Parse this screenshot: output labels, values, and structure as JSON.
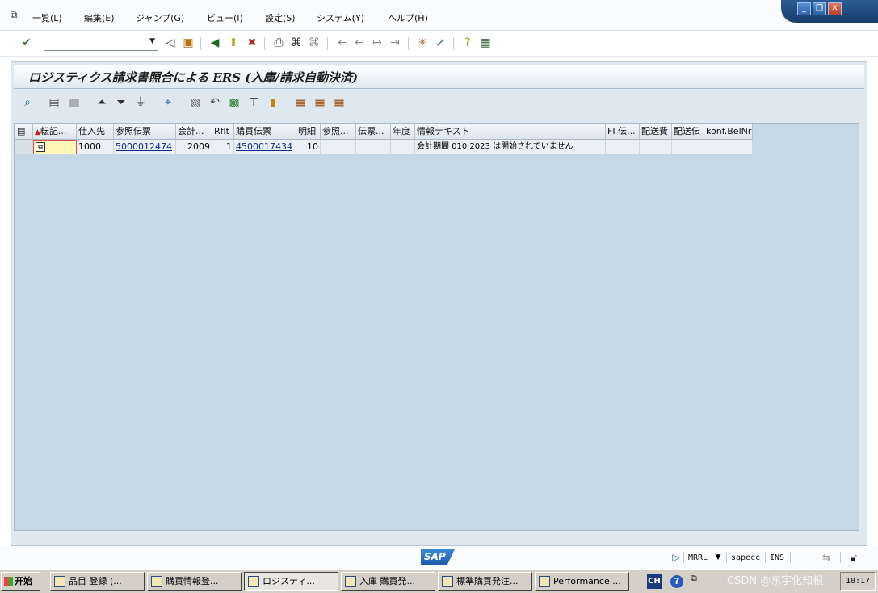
{
  "menu": [
    "一覧(L)",
    "編集(E)",
    "ジャンプ(G)",
    "ビュー(I)",
    "設定(S)",
    "システム(Y)",
    "ヘルプ(H)"
  ],
  "window_controls": [
    "_",
    "❐",
    "✕"
  ],
  "toolbar": {
    "command_value": "",
    "command_placeholder": ""
  },
  "title": "ロジスティクス請求書照合による ERS (入庫/請求自動決済)",
  "grid": {
    "headers": [
      "転記...",
      "仕入先",
      "参照伝票",
      "会計...",
      "Rflt",
      "購買伝票",
      "明細",
      "参照...",
      "伝票...",
      "年度",
      "情報テキスト",
      "FI 伝...",
      "配送費",
      "配送伝",
      "konf.BelNr"
    ],
    "rows": [
      {
        "vendor": "1000",
        "ref_doc": "5000012474",
        "fiscal_year": "2009",
        "rflt": "1",
        "po": "4500017434",
        "item": "10",
        "info": "会計期間 010 2023 は開始されていません"
      }
    ]
  },
  "status": {
    "logo": "SAP",
    "transaction": "MRRL",
    "system": "sapecc",
    "mode": "INS"
  },
  "taskbar": {
    "start": "开始",
    "tasks": [
      "品目 登録 (...",
      "購買情報登...",
      "ロジスティ...",
      "入庫 購買発...",
      "標準購買発注...",
      "Performance ..."
    ],
    "lang": "CH",
    "clock": "10:17"
  },
  "watermark": "CSDN @东宇化知根"
}
